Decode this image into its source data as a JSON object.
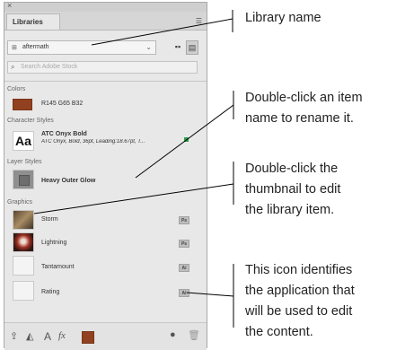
{
  "panel": {
    "tab_label": "Libraries",
    "library_name": "aftermath",
    "search_placeholder": "Search Adobe Stock",
    "sections": {
      "colors": "Colors",
      "character_styles": "Character Styles",
      "layer_styles": "Layer Styles",
      "graphics": "Graphics"
    },
    "color_item": {
      "label": "R145 G65 B32",
      "swatch": "#91411f"
    },
    "char_style": {
      "thumb_text": "Aa",
      "name": "ATC Onyx Bold",
      "detail": "ATC Onyx, Bold, 36pt, Leading:18.67pt, T..."
    },
    "layer_style": {
      "name": "Heavy Outer Glow"
    },
    "graphics": [
      {
        "name": "Storm",
        "app": "Ps"
      },
      {
        "name": "Lightning",
        "app": "Ps"
      },
      {
        "name": "Tantamount",
        "app": "Ai"
      },
      {
        "name": "Rating",
        "app": "Ai"
      }
    ]
  },
  "annotations": {
    "library_name": "Library name",
    "rename": [
      "Double-click an item",
      "name to rename it."
    ],
    "edit": [
      "Double-click the",
      "thumbnail to edit",
      "the library item."
    ],
    "app_icon": [
      "This icon identifies",
      "the application that",
      "will be used to edit",
      "the content."
    ]
  }
}
